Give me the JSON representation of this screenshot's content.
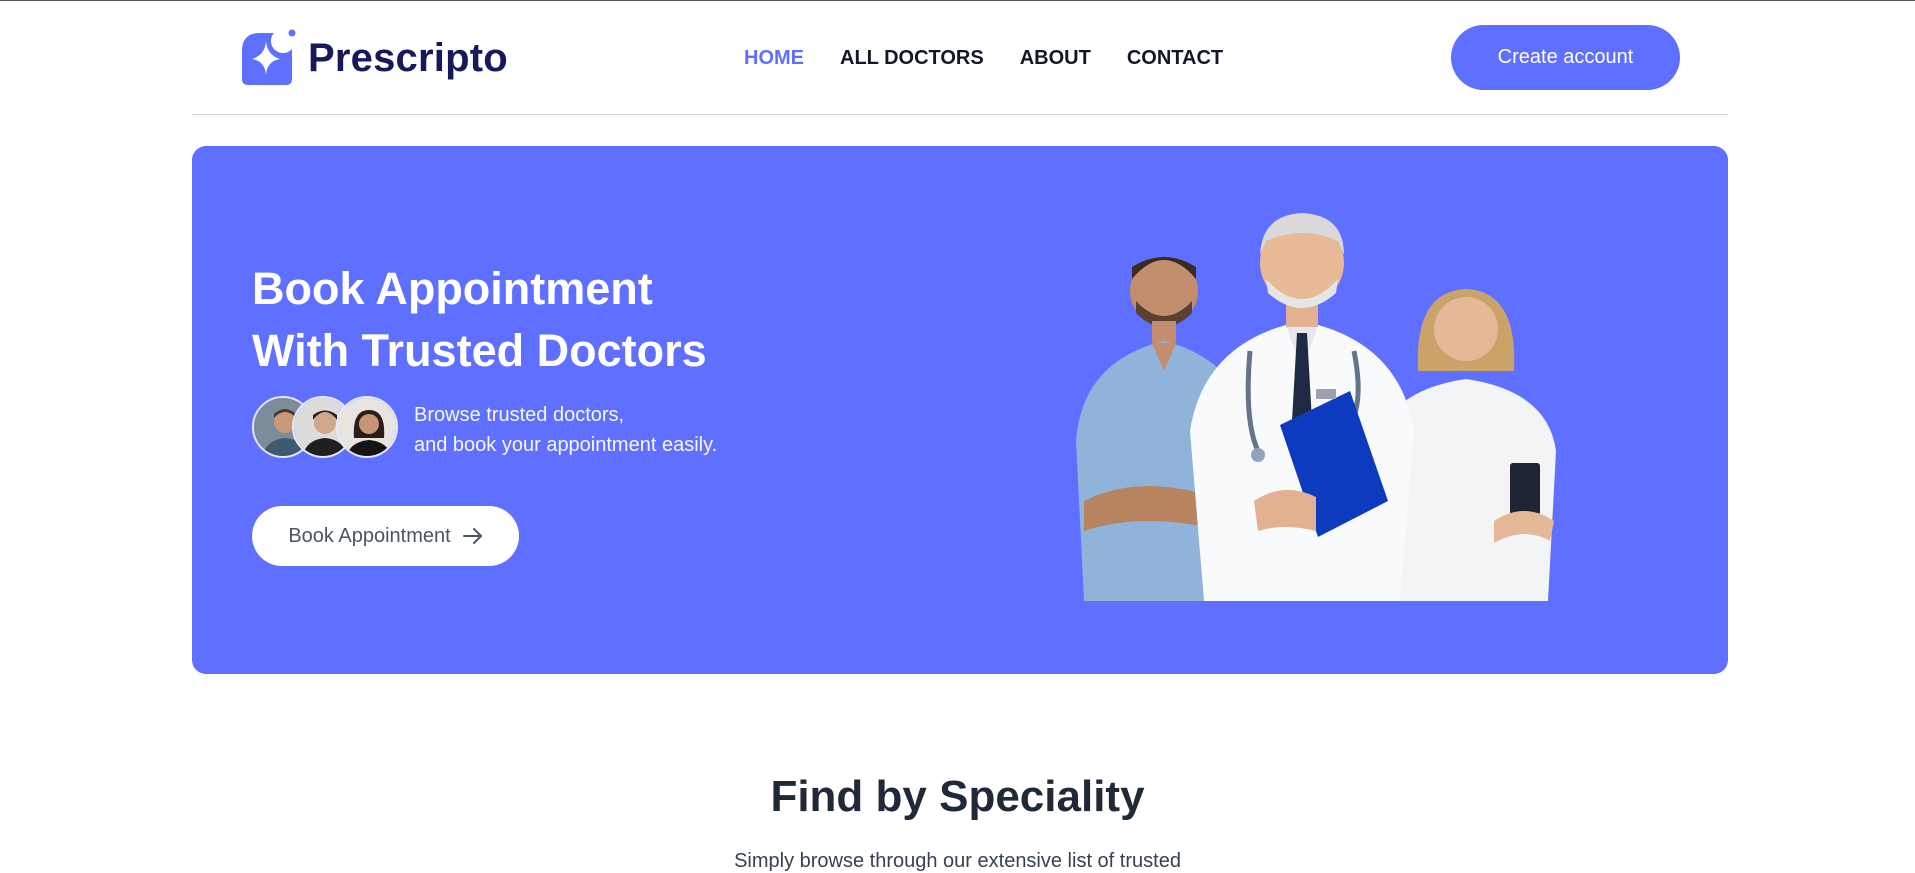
{
  "brand": {
    "name": "Prescripto",
    "color": "#5f6fff",
    "dark": "#161a5c"
  },
  "nav": {
    "items": [
      {
        "label": "HOME",
        "active": true
      },
      {
        "label": "ALL DOCTORS",
        "active": false
      },
      {
        "label": "ABOUT",
        "active": false
      },
      {
        "label": "CONTACT",
        "active": false
      }
    ]
  },
  "header": {
    "cta_label": "Create account"
  },
  "hero": {
    "title_line1": "Book Appointment",
    "title_line2": "With Trusted Doctors",
    "subtitle_line1": "Browse trusted doctors,",
    "subtitle_line2": "and book your appointment easily.",
    "button_label": "Book Appointment",
    "button_icon": "arrow-right-icon",
    "background": "#5f6fff"
  },
  "speciality": {
    "title": "Find by Speciality",
    "subtitle": "Simply browse through our extensive list of trusted"
  }
}
